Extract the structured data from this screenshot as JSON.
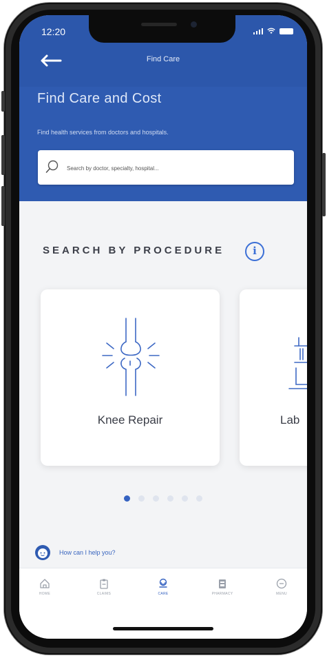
{
  "status_bar": {
    "time": "12:20"
  },
  "nav": {
    "title": "Find Care"
  },
  "hero": {
    "title": "Find Care and Cost",
    "subtitle": "Find health services from doctors and hospitals.",
    "search_placeholder": "Search by doctor, specialty, hospital..."
  },
  "procedures": {
    "section_title": "SEARCH BY PROCEDURE",
    "cards": [
      {
        "label": "Knee Repair",
        "icon": "knee-joint-icon"
      },
      {
        "label": "Lab",
        "icon": "lab-icon"
      }
    ],
    "pagination": {
      "total": 6,
      "active": 1
    }
  },
  "help": {
    "text": "How can I help you?"
  },
  "tabbar": {
    "tabs": [
      {
        "label": "HOME",
        "icon": "home-icon"
      },
      {
        "label": "CLAIMS",
        "icon": "clipboard-icon"
      },
      {
        "label": "CARE",
        "icon": "stethoscope-icon",
        "active": true
      },
      {
        "label": "PHARMACY",
        "icon": "pharmacy-icon"
      },
      {
        "label": "MENU",
        "icon": "menu-icon"
      }
    ]
  },
  "colors": {
    "header_blue": "#2f5bb1",
    "accent_blue": "#3562c1",
    "background": "#f3f4f6"
  }
}
